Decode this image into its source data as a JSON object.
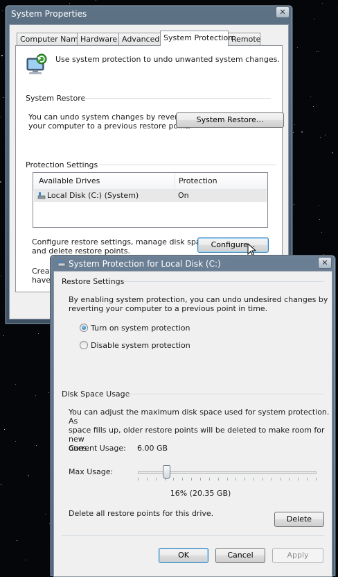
{
  "sys_properties": {
    "title": "System Properties",
    "close_glyph": "✕",
    "tabs": [
      {
        "label": "Computer Name"
      },
      {
        "label": "Hardware"
      },
      {
        "label": "Advanced"
      },
      {
        "label": "System Protection"
      },
      {
        "label": "Remote"
      }
    ],
    "intro_text": "Use system protection to undo unwanted system changes.",
    "system_restore": {
      "group_label": "System Restore",
      "description_line1": "You can undo system changes by reverting",
      "description_line2": "your computer to a previous restore point.",
      "button_label": "System Restore..."
    },
    "protection_settings": {
      "group_label": "Protection Settings",
      "columns": [
        "Available Drives",
        "Protection"
      ],
      "rows": [
        {
          "drive": "Local Disk (C:) (System)",
          "protection": "On"
        }
      ],
      "configure_line1": "Configure restore settings, manage disk space,",
      "configure_line2": "and delete restore points.",
      "configure_button": "Configure...",
      "create_line1": "Create",
      "create_line2": "have s"
    }
  },
  "sys_protection_dialog": {
    "title": "System Protection for Local Disk (C:)",
    "close_glyph": "✕",
    "restore_settings": {
      "group_label": "Restore Settings",
      "description_line1": "By enabling system protection, you can undo undesired changes by",
      "description_line2": "reverting your computer to a previous point in time.",
      "options": [
        {
          "label": "Turn on system protection",
          "selected": true
        },
        {
          "label": "Disable system protection",
          "selected": false
        }
      ]
    },
    "disk_space": {
      "group_label": "Disk Space Usage",
      "description_line1": "You can adjust the maximum disk space used for system protection. As",
      "description_line2": "space fills up, older restore points will be deleted to make room for new",
      "description_line3": "ones.",
      "current_usage_label": "Current Usage:",
      "current_usage_value": "6.00 GB",
      "max_usage_label": "Max Usage:",
      "max_usage_percent": 16,
      "max_usage_text": "16% (20.35 GB)",
      "delete_text": "Delete all restore points for this drive.",
      "delete_button": "Delete"
    },
    "buttons": {
      "ok": "OK",
      "cancel": "Cancel",
      "apply": "Apply"
    }
  }
}
